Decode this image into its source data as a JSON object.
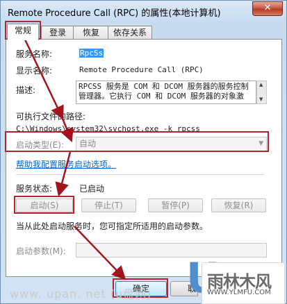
{
  "window": {
    "title": "Remote Procedure Call (RPC) 的属性(本地计算机)",
    "close_glyph": "✕"
  },
  "tabs": [
    {
      "label": "常规"
    },
    {
      "label": "登录"
    },
    {
      "label": "恢复"
    },
    {
      "label": "依存关系"
    }
  ],
  "general": {
    "service_name_label": "服务名称:",
    "service_name_value": "RpcSs",
    "display_name_label": "显示名称:",
    "display_name_value": "Remote Procedure Call (RPC)",
    "description_label": "描述:",
    "description_lines": [
      "RPCSS 服务是 COM 和 DCOM 服务器的服务控制",
      "管理器。它执行 COM 和 DCOM 服务器的对象激"
    ],
    "exe_path_label": "可执行文件的路径:",
    "exe_path_value": "C:\\Windows\\system32\\svchost.exe -k rpcss",
    "startup_type_label": "启动类型(E):",
    "startup_type_value": "自动",
    "help_link": "帮助我配置服务启动选项。",
    "status_label": "服务状态:",
    "status_value": "已启动",
    "buttons": {
      "start": "启动(S)",
      "stop": "停止(T)",
      "pause": "暂停(P)",
      "resume": "恢复(R)"
    },
    "start_hint": "当从此处启动服务时，您可指定所适用的启动参数。",
    "start_params_label": "启动参数(M):"
  },
  "footer": {
    "ok": "确定",
    "next_partial": "取"
  },
  "watermark": {
    "url_text": "www. upan. net (u盘网)",
    "logo_letter": "U",
    "logo_name": "雨林木风",
    "logo_url": "WWW.YLMFU.COM"
  },
  "colors": {
    "highlight": "#b3242c",
    "link": "#0066cc",
    "selection": "#3399ff"
  }
}
